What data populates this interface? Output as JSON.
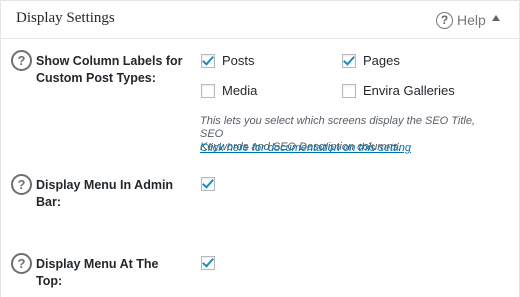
{
  "header": {
    "title": "Display Settings",
    "help_icon_glyph": "?",
    "help_label": "Help",
    "toggle_icon": "caret-up-icon"
  },
  "settings": {
    "column_labels": {
      "help_glyph": "?",
      "label_line1": "Show Column Labels for",
      "label_line2": "Custom Post Types:",
      "options": [
        {
          "label": "Posts",
          "checked": true
        },
        {
          "label": "Pages",
          "checked": true
        },
        {
          "label": "Media",
          "checked": false
        },
        {
          "label": "Envira Galleries",
          "checked": false
        }
      ],
      "description_line1": "This lets you select which screens display the SEO Title, SEO",
      "description_line2": "Keywords and SEO Description columns.",
      "doc_link": "Click here for documentation on this setting"
    },
    "admin_bar": {
      "help_glyph": "?",
      "label_line1": "Display Menu In Admin",
      "label_line2": "Bar:",
      "checked": true
    },
    "menu_top": {
      "help_glyph": "?",
      "label_line1": "Display Menu At The",
      "label_line2": "Top:",
      "checked": true
    }
  },
  "colors": {
    "accent_check": "#1e8cbe",
    "link": "#0073aa"
  }
}
